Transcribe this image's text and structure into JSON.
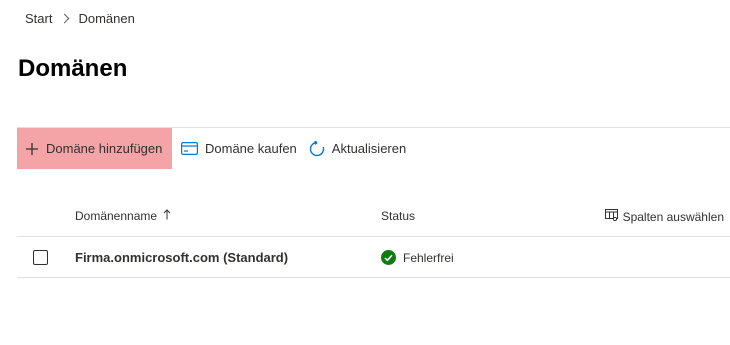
{
  "breadcrumb": {
    "items": [
      "Start",
      "Domänen"
    ]
  },
  "page": {
    "title": "Domänen"
  },
  "command_bar": {
    "add_domain": {
      "label": "Domäne hinzufügen",
      "icon": "plus-icon"
    },
    "buy_domain": {
      "label": "Domäne kaufen",
      "icon": "card-icon"
    },
    "refresh": {
      "label": "Aktualisieren",
      "icon": "refresh-icon"
    }
  },
  "table": {
    "columns": {
      "name": "Domänenname",
      "status": "Status",
      "choose_columns": "Spalten auswählen"
    },
    "sort_icon": "arrow-up-icon",
    "rows": [
      {
        "name": "Firma.onmicrosoft.com (Standard)",
        "status": "Fehlerfrei"
      }
    ]
  },
  "colors": {
    "highlight": "#f4a3a7",
    "accent": "#0078d4",
    "status_ok": "#107c10"
  }
}
